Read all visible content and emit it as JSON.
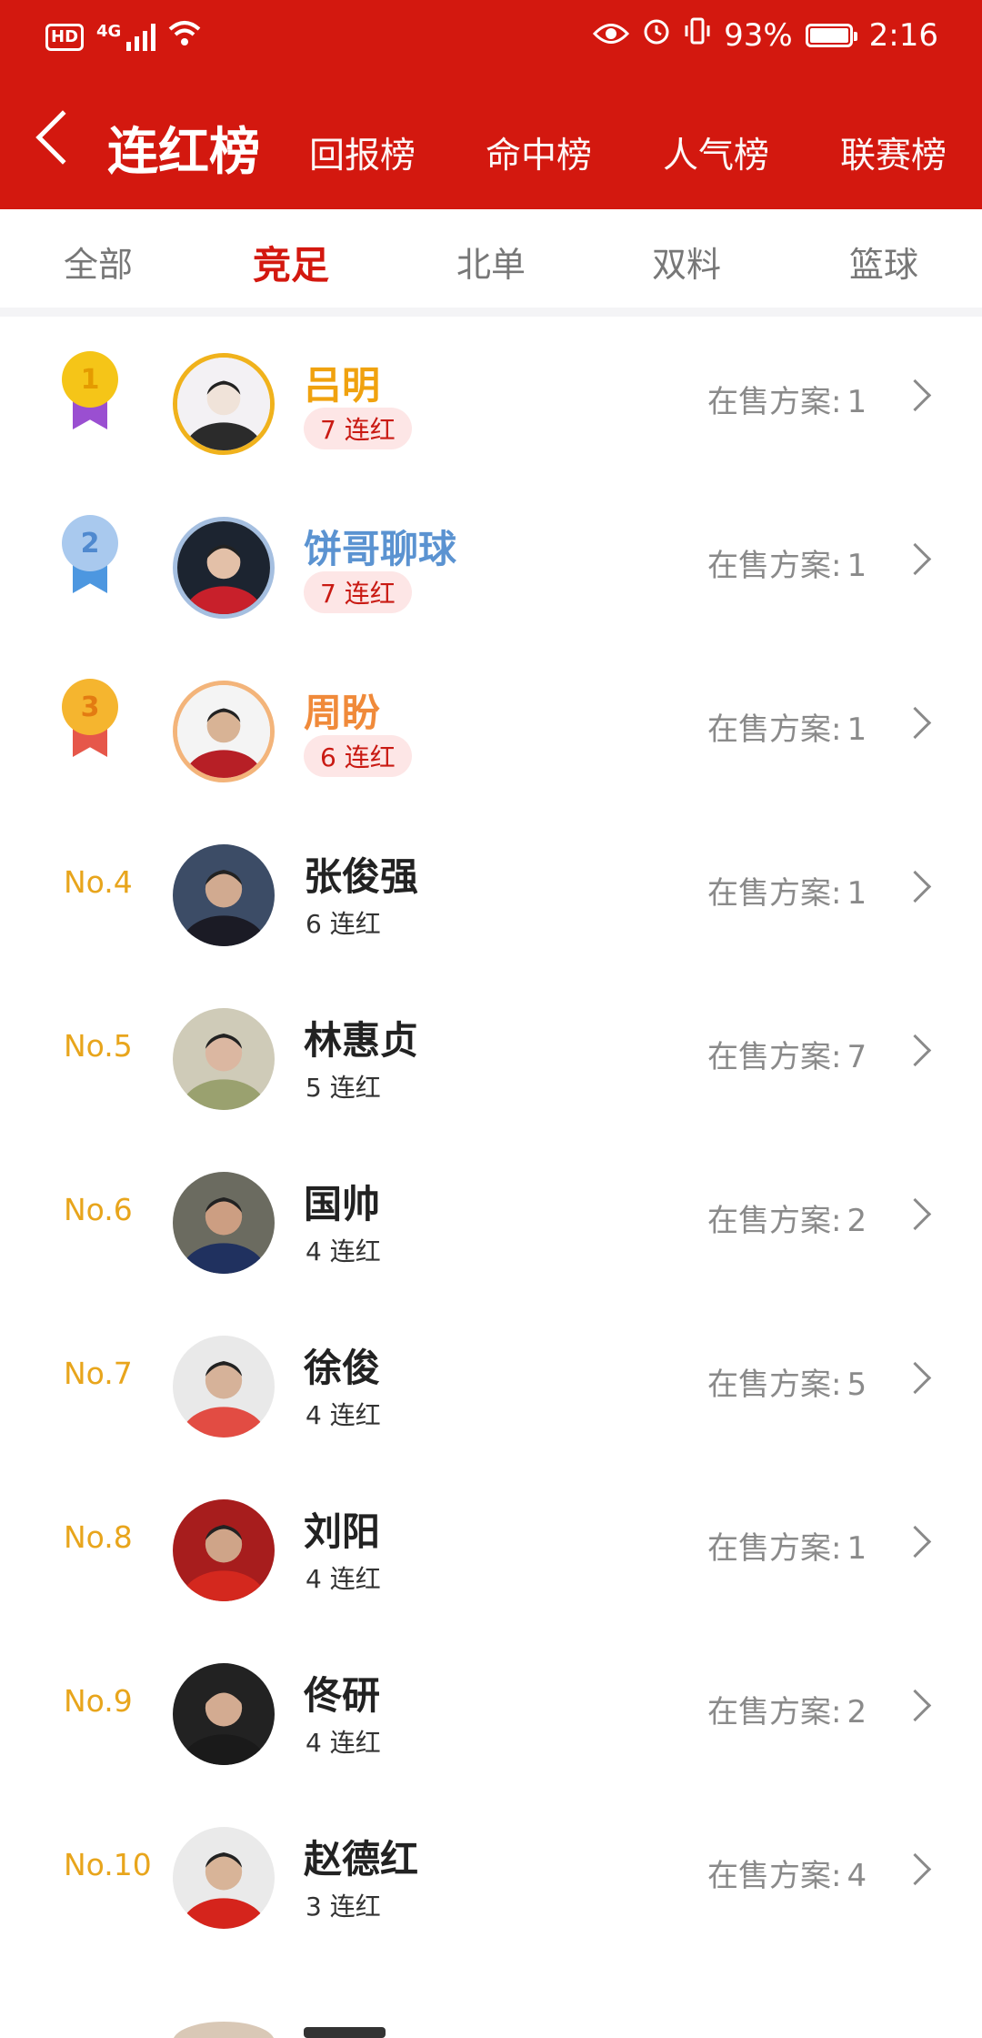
{
  "status_bar": {
    "network": "4G",
    "hd_label": "HD",
    "battery": "93%",
    "battery_level": 0.93,
    "time": "2:16"
  },
  "header": {
    "title": "连红榜",
    "tabs": [
      "回报榜",
      "命中榜",
      "人气榜",
      "联赛榜"
    ]
  },
  "subtabs": {
    "items": [
      "全部",
      "竞足",
      "北单",
      "双料",
      "篮球"
    ],
    "active": "竞足"
  },
  "sale_label": "在售方案:",
  "colors": {
    "brand": "#d3180f",
    "gold": "#f0b21c",
    "silver": "#5b93d1",
    "bronze": "#f08a3a",
    "rank_text": "#e8a51c"
  },
  "list": [
    {
      "rank": "1",
      "name": "吕明",
      "streak": "7 连红",
      "on_sale": "1"
    },
    {
      "rank": "2",
      "name": "饼哥聊球",
      "streak": "7 连红",
      "on_sale": "1"
    },
    {
      "rank": "3",
      "name": "周盼",
      "streak": "6 连红",
      "on_sale": "1"
    },
    {
      "rank": "No.4",
      "name": "张俊强",
      "streak": "6 连红",
      "on_sale": "1"
    },
    {
      "rank": "No.5",
      "name": "林惠贞",
      "streak": "5 连红",
      "on_sale": "7"
    },
    {
      "rank": "No.6",
      "name": "国帅",
      "streak": "4 连红",
      "on_sale": "2"
    },
    {
      "rank": "No.7",
      "name": "徐俊",
      "streak": "4 连红",
      "on_sale": "5"
    },
    {
      "rank": "No.8",
      "name": "刘阳",
      "streak": "4 连红",
      "on_sale": "1"
    },
    {
      "rank": "No.9",
      "name": "佟研",
      "streak": "4 连红",
      "on_sale": "2"
    },
    {
      "rank": "No.10",
      "name": "赵德红",
      "streak": "3 连红",
      "on_sale": "4"
    }
  ]
}
